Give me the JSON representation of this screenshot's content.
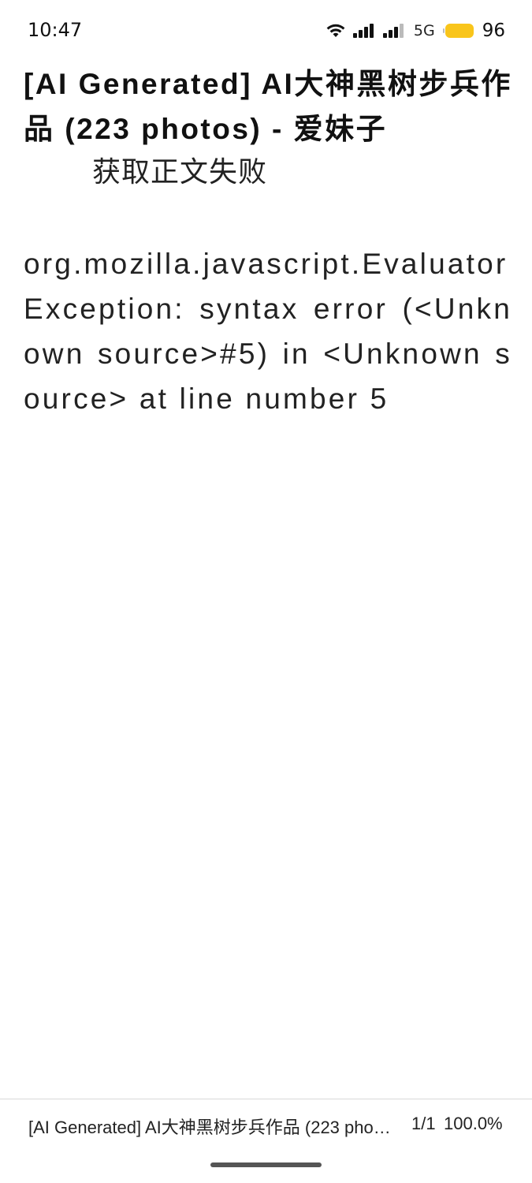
{
  "status_bar": {
    "time": "10:47",
    "network": "5G",
    "battery": "96",
    "battery_color": "#F9C51B",
    "icons": [
      "wifi-icon",
      "signal-icon",
      "signal-icon",
      "battery-icon"
    ]
  },
  "content": {
    "title": "[AI Generated] AI大神黑树步兵作品 (223 photos) - 爱妹子",
    "fail_message": "获取正文失败",
    "error_message": "org.mozilla.javascript.EvaluatorException: syntax error (<Unknown source>#5) in <Unknown source> at line number 5"
  },
  "footer": {
    "chapter_title": "[AI Generated] AI大神黑树步兵作品 (223 photos) - 爱妹子",
    "page": "1/1",
    "progress": "100.0%"
  }
}
